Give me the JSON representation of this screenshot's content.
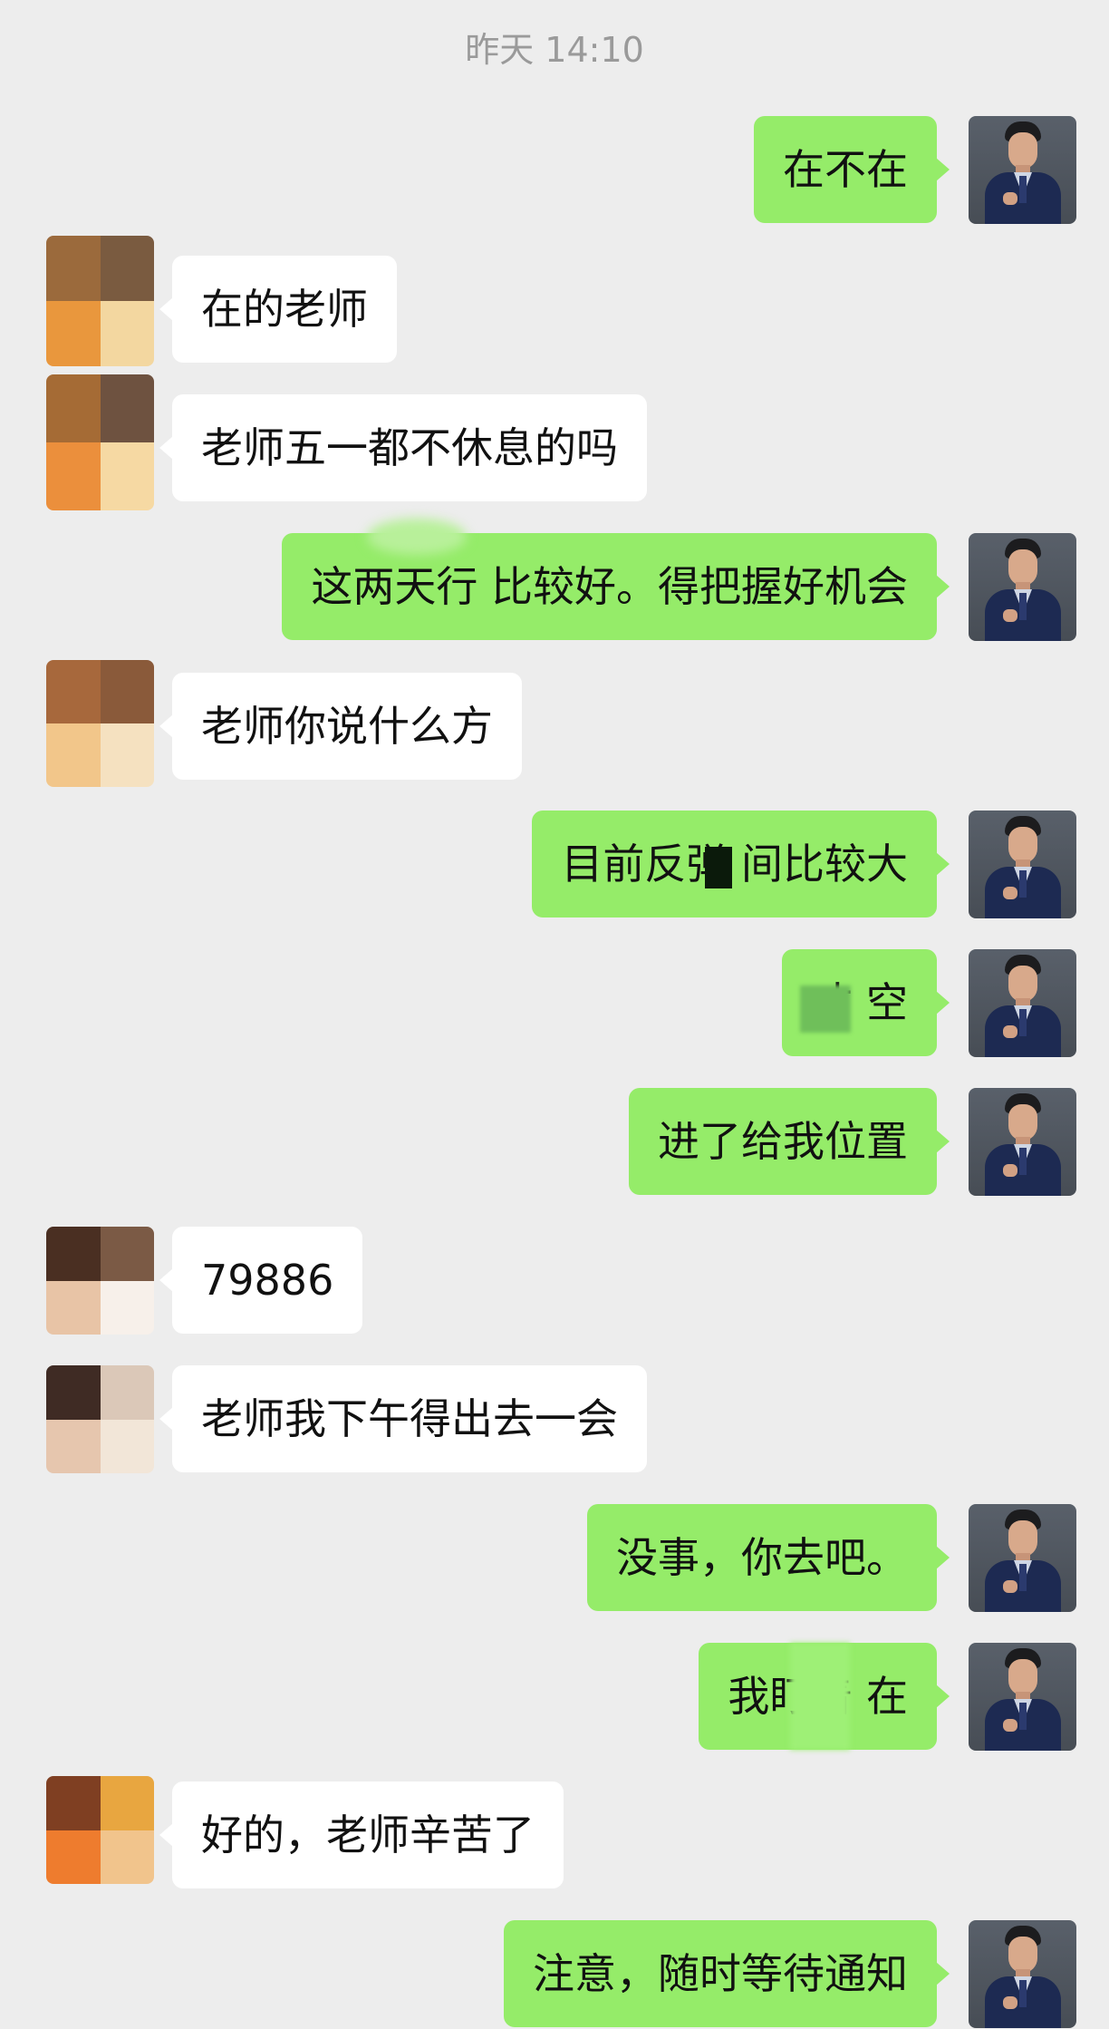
{
  "timestamp": "昨天 14:10",
  "messages": [
    {
      "side": "out",
      "text": "在不在"
    },
    {
      "side": "in",
      "text": "在的老师"
    },
    {
      "side": "in",
      "text": "老师五一都不休息的吗"
    },
    {
      "side": "out",
      "text": "这两天行  比较好。得把握好机会"
    },
    {
      "side": "in",
      "text": "老师你说什么方"
    },
    {
      "side": "out",
      "text": "目前反弹  间比较大"
    },
    {
      "side": "out",
      "text": "才  空"
    },
    {
      "side": "out",
      "text": "进了给我位置"
    },
    {
      "side": "in",
      "text": "79886"
    },
    {
      "side": "in",
      "text": "老师我下午得出去一会"
    },
    {
      "side": "out",
      "text": "没事，你去吧。"
    },
    {
      "side": "out",
      "text": "我盯着  在"
    },
    {
      "side": "in",
      "text": "好的，老师辛苦了"
    },
    {
      "side": "out",
      "text": "注意，随时等待通知"
    }
  ],
  "colors": {
    "background": "#ededed",
    "outgoing_bubble": "#95ec69",
    "incoming_bubble": "#ffffff",
    "timestamp_text": "#9a9a9a"
  },
  "icons": {
    "self_avatar": "man-in-suit-portrait",
    "contact_avatar": "mosaic-blurred-avatar"
  }
}
